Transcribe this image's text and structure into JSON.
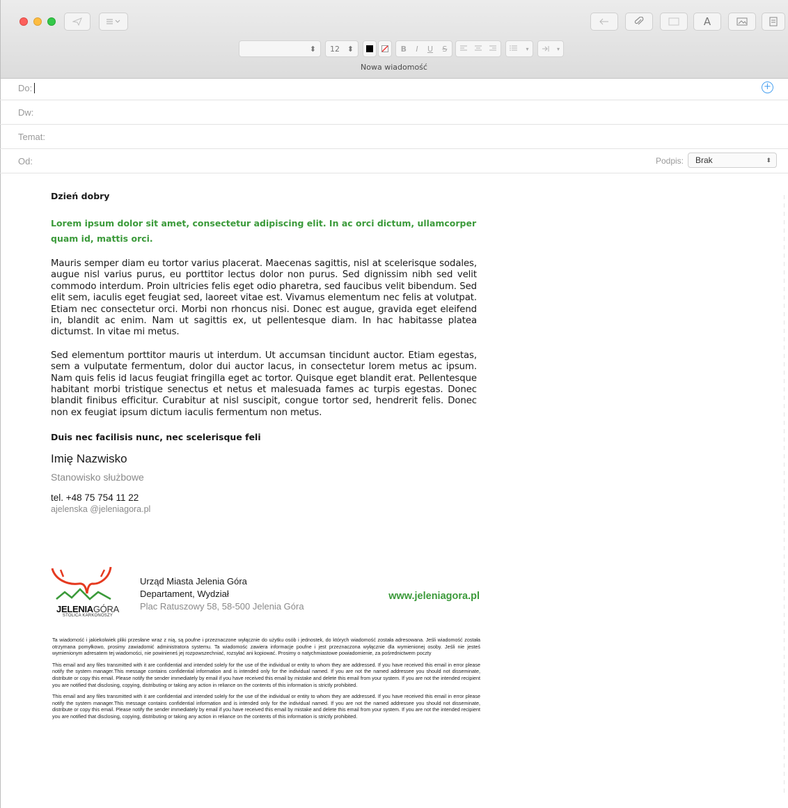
{
  "window": {
    "title": "Nowa wiadomość"
  },
  "toolbar": {
    "font_size": "12",
    "colors": {
      "text_color": "#000000",
      "accent_green": "#3b9a3a"
    }
  },
  "header": {
    "to_label": "Do:",
    "cc_label": "Dw:",
    "subject_label": "Temat:",
    "from_label": "Od:",
    "signature_label": "Podpis:",
    "signature_value": "Brak"
  },
  "email": {
    "greeting": "Dzień dobry",
    "lead": "Lorem ipsum dolor sit amet, consectetur adipiscing elit. In ac orci dictum, ullamcorper quam id, mattis orci.",
    "paragraphs": [
      "Mauris semper diam eu tortor varius placerat. Maecenas sagittis, nisl at scelerisque sodales, augue nisl varius purus, eu porttitor lectus dolor non purus. Sed dignissim nibh sed velit commodo interdum. Proin ultricies felis eget odio pharetra, sed faucibus velit bibendum. Sed elit sem, iaculis eget feugiat sed, laoreet vitae est. Vivamus elementum nec felis at volutpat. Etiam nec consectetur orci. Morbi non rhoncus nisi. Donec est augue, gravida eget eleifend in, blandit ac enim. Nam ut sagittis ex, ut pellentesque diam. In hac habitasse platea dictumst. In vitae mi metus.",
      "Sed elementum porttitor mauris ut interdum. Ut accumsan tincidunt auctor. Etiam egestas, sem a vulputate fermentum, dolor dui auctor lacus, in consectetur lorem metus ac ipsum. Nam quis felis id lacus feugiat fringilla eget ac tortor. Quisque eget blandit erat. Pellentesque habitant morbi tristique senectus et netus et malesuada fames ac turpis egestas. Donec blandit finibus efficitur. Curabitur at nisl suscipit, congue tortor sed, hendrerit felis. Donec non ex feugiat ipsum dictum iaculis fermentum non metus."
    ],
    "closing": "Duis nec facilisis nunc, nec scelerisque feli"
  },
  "signature": {
    "name": "Imię Nazwisko",
    "position": "Stanowisko służbowe",
    "phone": "tel. +48 75 754 11 22",
    "email": "ajelenska   @jeleniagora.pl"
  },
  "organization": {
    "logo_main_bold": "JELENIA",
    "logo_main_thin": "GÓRA",
    "logo_sub": "STOLICA KARKONOSZY",
    "name": "Urząd Miasta Jelenia Góra",
    "department": "Departament, Wydział",
    "address": "Plac Ratuszowy 58, 58-500 Jelenia Góra",
    "website": "www.jeleniagora.pl"
  },
  "disclaimer": [
    "Ta wiadomość i jakiekolwiek pliki przesłane wraz z nią, są poufne i przeznaczone wyłącznie do użytku osób i jednostek, do których wiadomość została adresowana. Jeśli wiadomość została otrzymana pomyłkowo, prosimy zawiadomić administratora systemu. Ta wiadomośc zawiera informacje poufne i jest przeznaczona wyłącznie dla wymienionej osoby. Jeśli nie jesteś wymienionym adresatem tej wiadomości, nie powinieneś jej rozpowszechniać, rozsyłać ani kopiować. Prosimy o natychmiastowe powiadomienie, za pośrednictwem poczty",
    "This email and any files transmitted with it are confidential and intended solely for the use of the individual or entity to whom they are addressed. If you have received this email in error please notify the system manager.This message contains confidential information and is intended only for the individual named. If you are not the named addressee you should not disseminate, distribute or copy this email. Please notify the sender immediately by email if you have received this email by mistake and delete this email from your system. If you are not the intended recipient you are notified that disclosing, copying, distributing or taking any action in reliance on the contents of this information is strictly prohibited.",
    "This email and any files transmitted with it are confidential and intended solely for the use of the individual or entity to whom they are addressed. If you have received this email in error please notify the system manager.This message contains confidential information and is intended only for the individual named. If you are not the named addressee you should not disseminate, distribute or copy this email. Please notify the sender immediately by email if you have received this email by mistake and delete this email from your system. If you are not the intended recipient you are notified that disclosing, copying, distributing or taking any action in reliance on the contents of this information is strictly prohibited."
  ]
}
